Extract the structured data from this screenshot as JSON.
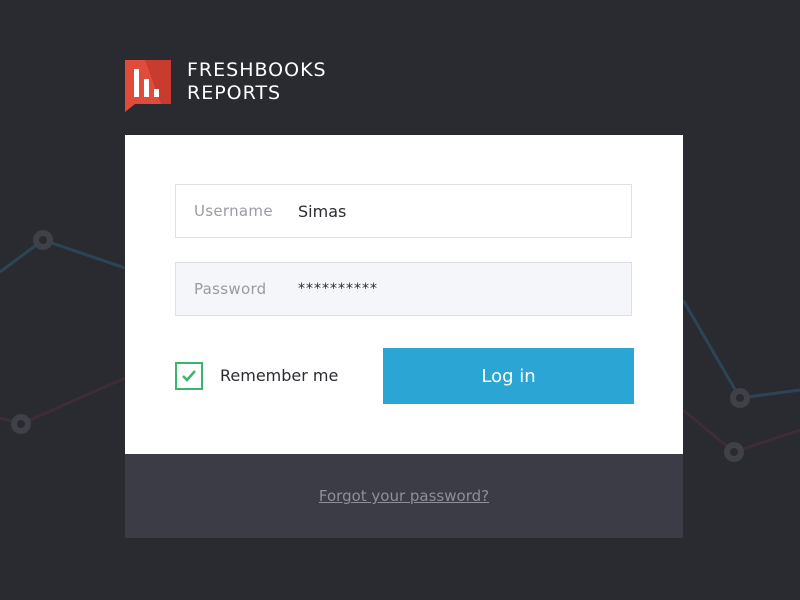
{
  "brand": {
    "line1": "FRESHBOOKS",
    "line2": "REPORTS",
    "logo_icon": "bar-chart-flag-icon",
    "logo_color": "#e04b3c"
  },
  "form": {
    "username": {
      "label": "Username",
      "value": "Simas"
    },
    "password": {
      "label": "Password",
      "value": "**********"
    },
    "remember": {
      "label": "Remember me",
      "checked": true
    },
    "login_label": "Log in"
  },
  "footer": {
    "forgot_label": "Forgot your password?"
  },
  "colors": {
    "background": "#2a2b30",
    "accent": "#2ba5d3",
    "check": "#39b56c",
    "footer": "#3b3c45"
  }
}
